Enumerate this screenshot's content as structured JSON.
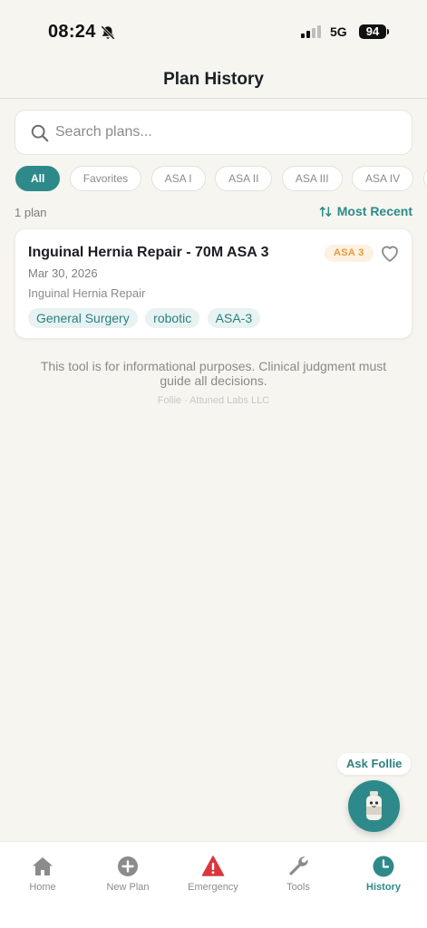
{
  "status_bar": {
    "time": "08:24",
    "network": "5G",
    "battery": "94"
  },
  "header": {
    "title": "Plan History"
  },
  "search": {
    "placeholder": "Search plans..."
  },
  "filters": [
    {
      "label": "All",
      "active": true
    },
    {
      "label": "Favorites",
      "active": false
    },
    {
      "label": "ASA I",
      "active": false
    },
    {
      "label": "ASA II",
      "active": false
    },
    {
      "label": "ASA III",
      "active": false
    },
    {
      "label": "ASA IV",
      "active": false
    }
  ],
  "list": {
    "count": "1 plan",
    "sort_label": "Most Recent"
  },
  "plans": [
    {
      "title": "Inguinal Hernia Repair - 70M ASA 3",
      "asa_badge": "ASA 3",
      "date": "Mar 30, 2026",
      "procedure": "Inguinal Hernia Repair",
      "tags": [
        "General Surgery",
        "robotic",
        "ASA-3"
      ]
    }
  ],
  "disclaimer": "This tool is for informational purposes. Clinical judgment must guide all decisions.",
  "credit": "Follie · Attuned Labs LLC",
  "assistant": {
    "label": "Ask Follie"
  },
  "nav": {
    "items": [
      {
        "label": "Home",
        "icon": "home-icon"
      },
      {
        "label": "New Plan",
        "icon": "plus-circle-icon"
      },
      {
        "label": "Emergency",
        "icon": "warning-triangle-icon"
      },
      {
        "label": "Tools",
        "icon": "wrench-icon"
      },
      {
        "label": "History",
        "icon": "clock-icon"
      }
    ],
    "active": "History"
  },
  "colors": {
    "accent": "#2e8a8a",
    "background": "#f6f5f0",
    "emergency": "#d9363e",
    "asa_badge_text": "#e49a3c",
    "asa_badge_bg": "#fdf1e2"
  }
}
